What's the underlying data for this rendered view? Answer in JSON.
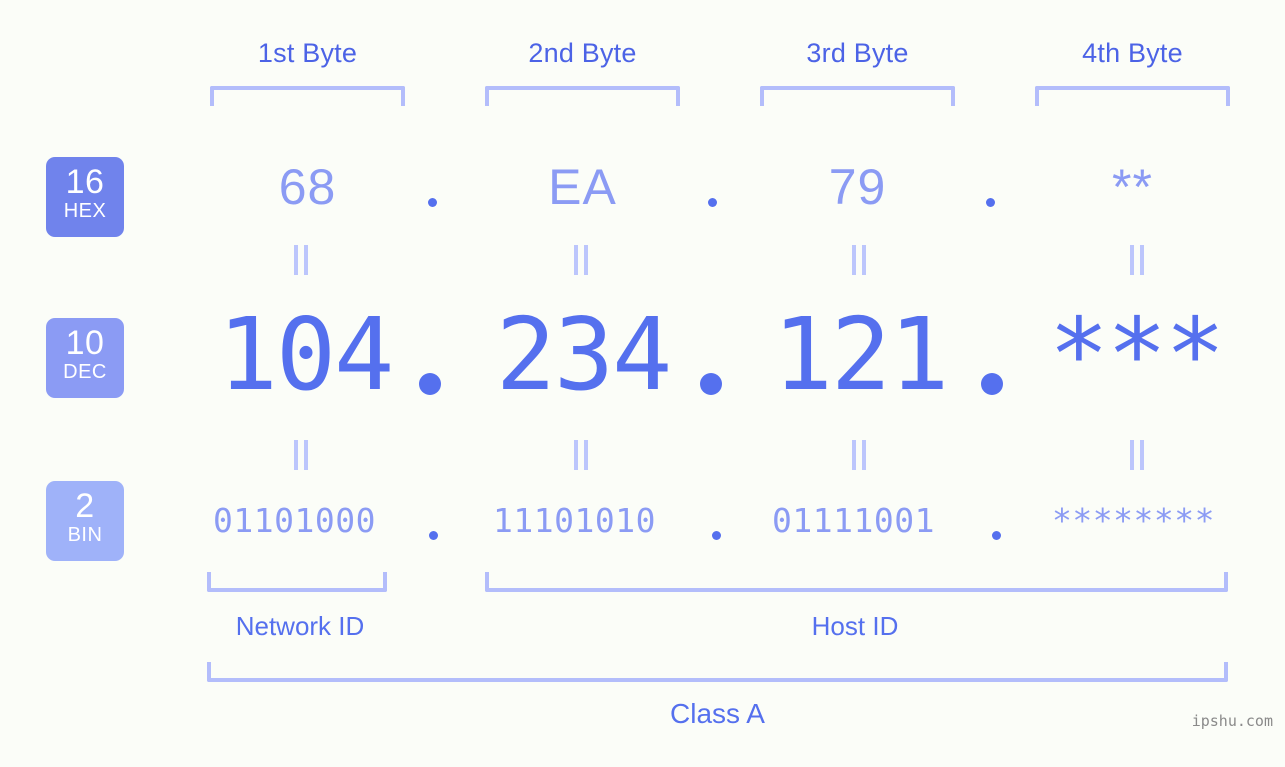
{
  "byte_headers": [
    {
      "label": "1st Byte"
    },
    {
      "label": "2nd Byte"
    },
    {
      "label": "3rd Byte"
    },
    {
      "label": "4th Byte"
    }
  ],
  "bases": [
    {
      "num": "16",
      "abbr": "HEX",
      "color": "#7083ec"
    },
    {
      "num": "10",
      "abbr": "DEC",
      "color": "#8b9bf4"
    },
    {
      "num": "2",
      "abbr": "BIN",
      "color": "#9fb2f9"
    }
  ],
  "rows": {
    "hex": {
      "values": [
        "68",
        "EA",
        "79",
        "**"
      ]
    },
    "dec": {
      "values": [
        "104",
        "234",
        "121",
        "***"
      ]
    },
    "bin": {
      "values": [
        "01101000",
        "11101010",
        "01111001",
        "********"
      ]
    }
  },
  "separator": ".",
  "equals_glyph": "=",
  "sections": {
    "network_id": "Network ID",
    "host_id": "Host ID",
    "class": "Class A"
  },
  "watermark": "ipshu.com",
  "colors": {
    "background": "#fbfdf8",
    "accent_strong": "#5570ee",
    "accent_mid": "#8b9bf4",
    "accent_light": "#b3bdfb",
    "header_text": "#4c63e6",
    "watermark": "#8a8a8a"
  }
}
